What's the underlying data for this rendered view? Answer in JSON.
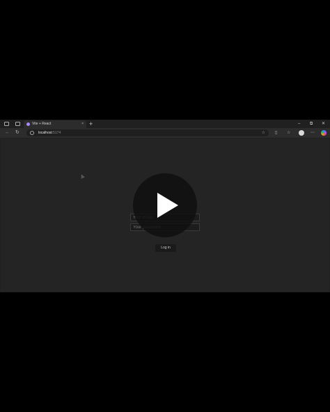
{
  "tab": {
    "title": "Vite + React",
    "close": "×"
  },
  "newtab": "+",
  "window_controls": {
    "minimize": "–",
    "maximize": "⧉",
    "close": "✕"
  },
  "nav": {
    "back": "←",
    "reload": "↻"
  },
  "address": {
    "host": "localhost",
    "port": ":5174"
  },
  "toolbar_icons": {
    "favorite": "☆",
    "split": "▯",
    "collections": "☆",
    "more": "⋯"
  },
  "login": {
    "email_placeholder": "Your Email",
    "password_placeholder": "Your password",
    "button_label": "Log in"
  },
  "colors": {
    "page_bg": "#242424",
    "browser_chrome": "#202020",
    "toolbar": "#2c2c2c"
  },
  "icons": [
    "sidebar-icon",
    "tab-actions-icon",
    "vite-favicon",
    "info-icon",
    "play-icon"
  ]
}
